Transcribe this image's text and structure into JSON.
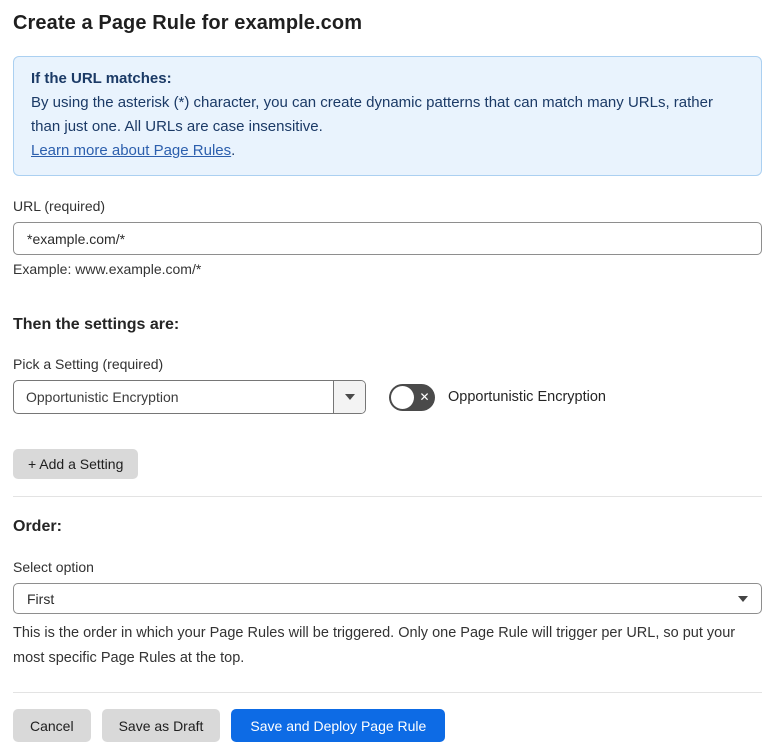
{
  "page": {
    "title": "Create a Page Rule for example.com"
  },
  "info_box": {
    "heading": "If the URL matches:",
    "body": "By using the asterisk (*) character, you can create dynamic patterns that can match many URLs, rather than just one. All URLs are case insensitive.",
    "link": "Learn more about Page Rules",
    "link_suffix": "."
  },
  "url_field": {
    "label": "URL (required)",
    "value": "*example.com/*",
    "helper": "Example: www.example.com/*"
  },
  "settings": {
    "heading": "Then the settings are:",
    "picker_label": "Pick a Setting (required)",
    "picker_value": "Opportunistic Encryption",
    "toggle_state": "off",
    "toggle_x": "✕",
    "toggle_label": "Opportunistic Encryption",
    "add_button_label": "+ Add a Setting"
  },
  "order": {
    "heading": "Order:",
    "select_label": "Select option",
    "select_value": "First",
    "helper": "This is the order in which your Page Rules will be triggered. Only one Page Rule will trigger per URL, so put your most specific Page Rules at the top."
  },
  "footer": {
    "cancel_label": "Cancel",
    "save_draft_label": "Save as Draft",
    "save_deploy_label": "Save and Deploy Page Rule"
  },
  "colors": {
    "primary_blue": "#0d6be5",
    "info_bg": "#e9f3fd",
    "info_border": "#abd0f1",
    "info_text": "#1b3a66",
    "link": "#2c5fad",
    "toggle_bg": "#4a4a4a",
    "button_gray": "#d9d9d9"
  }
}
